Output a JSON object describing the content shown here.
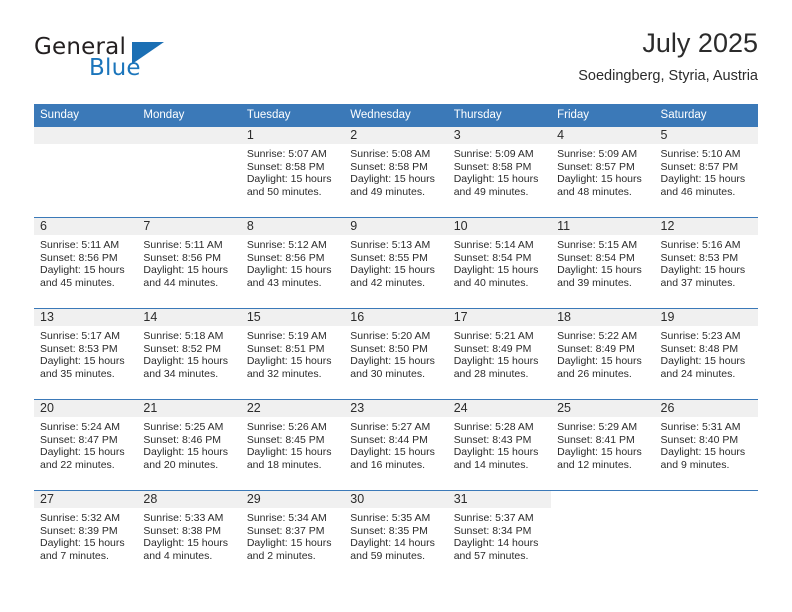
{
  "brand": {
    "name_part1": "General",
    "name_part2": "Blue",
    "triangle_color": "#1b6fb4",
    "accent_color": "#3b79b8"
  },
  "header": {
    "title": "July 2025",
    "location": "Soedingberg, Styria, Austria"
  },
  "weekdays": [
    "Sunday",
    "Monday",
    "Tuesday",
    "Wednesday",
    "Thursday",
    "Friday",
    "Saturday"
  ],
  "weeks": [
    [
      {
        "day": "",
        "sunrise": "",
        "sunset": "",
        "daylight": "",
        "empty": true
      },
      {
        "day": "",
        "sunrise": "",
        "sunset": "",
        "daylight": "",
        "empty": true
      },
      {
        "day": "1",
        "sunrise": "Sunrise: 5:07 AM",
        "sunset": "Sunset: 8:58 PM",
        "daylight": "Daylight: 15 hours and 50 minutes."
      },
      {
        "day": "2",
        "sunrise": "Sunrise: 5:08 AM",
        "sunset": "Sunset: 8:58 PM",
        "daylight": "Daylight: 15 hours and 49 minutes."
      },
      {
        "day": "3",
        "sunrise": "Sunrise: 5:09 AM",
        "sunset": "Sunset: 8:58 PM",
        "daylight": "Daylight: 15 hours and 49 minutes."
      },
      {
        "day": "4",
        "sunrise": "Sunrise: 5:09 AM",
        "sunset": "Sunset: 8:57 PM",
        "daylight": "Daylight: 15 hours and 48 minutes."
      },
      {
        "day": "5",
        "sunrise": "Sunrise: 5:10 AM",
        "sunset": "Sunset: 8:57 PM",
        "daylight": "Daylight: 15 hours and 46 minutes."
      }
    ],
    [
      {
        "day": "6",
        "sunrise": "Sunrise: 5:11 AM",
        "sunset": "Sunset: 8:56 PM",
        "daylight": "Daylight: 15 hours and 45 minutes."
      },
      {
        "day": "7",
        "sunrise": "Sunrise: 5:11 AM",
        "sunset": "Sunset: 8:56 PM",
        "daylight": "Daylight: 15 hours and 44 minutes."
      },
      {
        "day": "8",
        "sunrise": "Sunrise: 5:12 AM",
        "sunset": "Sunset: 8:56 PM",
        "daylight": "Daylight: 15 hours and 43 minutes."
      },
      {
        "day": "9",
        "sunrise": "Sunrise: 5:13 AM",
        "sunset": "Sunset: 8:55 PM",
        "daylight": "Daylight: 15 hours and 42 minutes."
      },
      {
        "day": "10",
        "sunrise": "Sunrise: 5:14 AM",
        "sunset": "Sunset: 8:54 PM",
        "daylight": "Daylight: 15 hours and 40 minutes."
      },
      {
        "day": "11",
        "sunrise": "Sunrise: 5:15 AM",
        "sunset": "Sunset: 8:54 PM",
        "daylight": "Daylight: 15 hours and 39 minutes."
      },
      {
        "day": "12",
        "sunrise": "Sunrise: 5:16 AM",
        "sunset": "Sunset: 8:53 PM",
        "daylight": "Daylight: 15 hours and 37 minutes."
      }
    ],
    [
      {
        "day": "13",
        "sunrise": "Sunrise: 5:17 AM",
        "sunset": "Sunset: 8:53 PM",
        "daylight": "Daylight: 15 hours and 35 minutes."
      },
      {
        "day": "14",
        "sunrise": "Sunrise: 5:18 AM",
        "sunset": "Sunset: 8:52 PM",
        "daylight": "Daylight: 15 hours and 34 minutes."
      },
      {
        "day": "15",
        "sunrise": "Sunrise: 5:19 AM",
        "sunset": "Sunset: 8:51 PM",
        "daylight": "Daylight: 15 hours and 32 minutes."
      },
      {
        "day": "16",
        "sunrise": "Sunrise: 5:20 AM",
        "sunset": "Sunset: 8:50 PM",
        "daylight": "Daylight: 15 hours and 30 minutes."
      },
      {
        "day": "17",
        "sunrise": "Sunrise: 5:21 AM",
        "sunset": "Sunset: 8:49 PM",
        "daylight": "Daylight: 15 hours and 28 minutes."
      },
      {
        "day": "18",
        "sunrise": "Sunrise: 5:22 AM",
        "sunset": "Sunset: 8:49 PM",
        "daylight": "Daylight: 15 hours and 26 minutes."
      },
      {
        "day": "19",
        "sunrise": "Sunrise: 5:23 AM",
        "sunset": "Sunset: 8:48 PM",
        "daylight": "Daylight: 15 hours and 24 minutes."
      }
    ],
    [
      {
        "day": "20",
        "sunrise": "Sunrise: 5:24 AM",
        "sunset": "Sunset: 8:47 PM",
        "daylight": "Daylight: 15 hours and 22 minutes."
      },
      {
        "day": "21",
        "sunrise": "Sunrise: 5:25 AM",
        "sunset": "Sunset: 8:46 PM",
        "daylight": "Daylight: 15 hours and 20 minutes."
      },
      {
        "day": "22",
        "sunrise": "Sunrise: 5:26 AM",
        "sunset": "Sunset: 8:45 PM",
        "daylight": "Daylight: 15 hours and 18 minutes."
      },
      {
        "day": "23",
        "sunrise": "Sunrise: 5:27 AM",
        "sunset": "Sunset: 8:44 PM",
        "daylight": "Daylight: 15 hours and 16 minutes."
      },
      {
        "day": "24",
        "sunrise": "Sunrise: 5:28 AM",
        "sunset": "Sunset: 8:43 PM",
        "daylight": "Daylight: 15 hours and 14 minutes."
      },
      {
        "day": "25",
        "sunrise": "Sunrise: 5:29 AM",
        "sunset": "Sunset: 8:41 PM",
        "daylight": "Daylight: 15 hours and 12 minutes."
      },
      {
        "day": "26",
        "sunrise": "Sunrise: 5:31 AM",
        "sunset": "Sunset: 8:40 PM",
        "daylight": "Daylight: 15 hours and 9 minutes."
      }
    ],
    [
      {
        "day": "27",
        "sunrise": "Sunrise: 5:32 AM",
        "sunset": "Sunset: 8:39 PM",
        "daylight": "Daylight: 15 hours and 7 minutes."
      },
      {
        "day": "28",
        "sunrise": "Sunrise: 5:33 AM",
        "sunset": "Sunset: 8:38 PM",
        "daylight": "Daylight: 15 hours and 4 minutes."
      },
      {
        "day": "29",
        "sunrise": "Sunrise: 5:34 AM",
        "sunset": "Sunset: 8:37 PM",
        "daylight": "Daylight: 15 hours and 2 minutes."
      },
      {
        "day": "30",
        "sunrise": "Sunrise: 5:35 AM",
        "sunset": "Sunset: 8:35 PM",
        "daylight": "Daylight: 14 hours and 59 minutes."
      },
      {
        "day": "31",
        "sunrise": "Sunrise: 5:37 AM",
        "sunset": "Sunset: 8:34 PM",
        "daylight": "Daylight: 14 hours and 57 minutes."
      },
      {
        "day": "",
        "sunrise": "",
        "sunset": "",
        "daylight": "",
        "blank": true
      },
      {
        "day": "",
        "sunrise": "",
        "sunset": "",
        "daylight": "",
        "blank": true
      }
    ]
  ]
}
